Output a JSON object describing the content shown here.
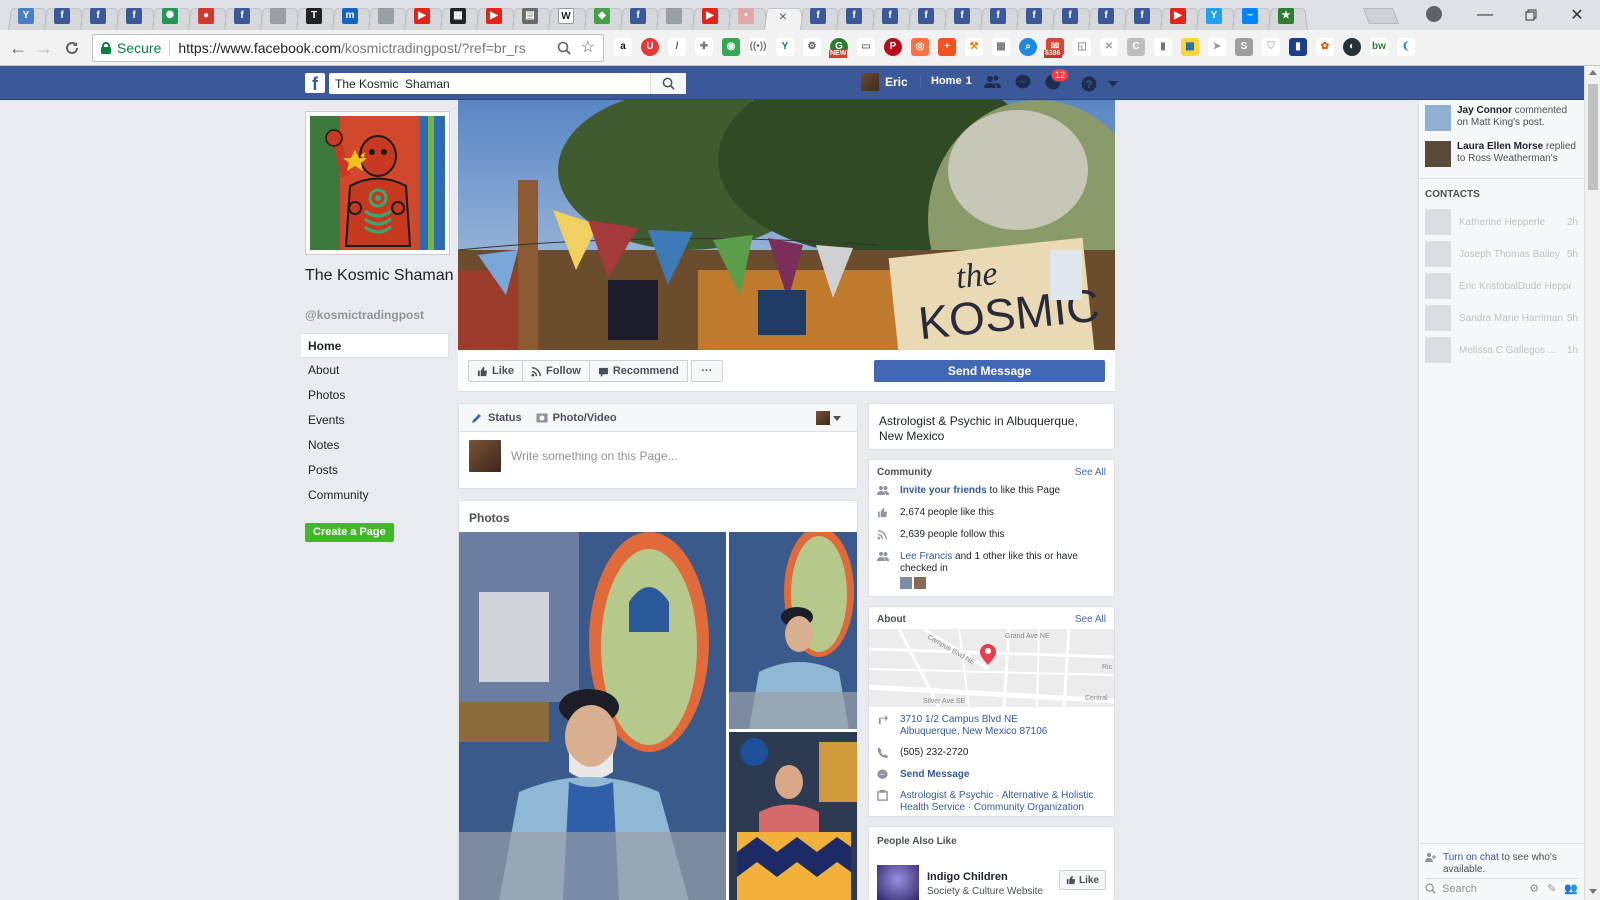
{
  "browser": {
    "tabs": [
      {
        "icon": "vivaldi-icon",
        "color": "#4a7ec9",
        "glyph": "Y"
      },
      {
        "icon": "facebook-icon",
        "color": "#3b5998",
        "glyph": "f"
      },
      {
        "icon": "facebook-icon",
        "color": "#3b5998",
        "glyph": "f"
      },
      {
        "icon": "facebook-icon",
        "color": "#3b5998",
        "glyph": "f"
      },
      {
        "icon": "starbucks-icon",
        "color": "#21975a",
        "glyph": "✺"
      },
      {
        "icon": "red-circle-icon",
        "color": "#d3382f",
        "glyph": "●"
      },
      {
        "icon": "facebook-icon",
        "color": "#3b5998",
        "glyph": "f"
      },
      {
        "icon": "document-icon",
        "color": "#9aa0a6",
        "glyph": ""
      },
      {
        "icon": "nytimes-icon",
        "color": "#222222",
        "glyph": "T"
      },
      {
        "icon": "m-icon",
        "color": "#1565c0",
        "glyph": "m"
      },
      {
        "icon": "document-icon",
        "color": "#9aa0a6",
        "glyph": ""
      },
      {
        "icon": "youtube-icon",
        "color": "#e62117",
        "glyph": "▶"
      },
      {
        "icon": "bbc-icon",
        "color": "#222222",
        "glyph": "▦"
      },
      {
        "icon": "youtube-icon",
        "color": "#e62117",
        "glyph": "▶"
      },
      {
        "icon": "image-icon",
        "color": "#6b6b6b",
        "glyph": "▤"
      },
      {
        "icon": "wikipedia-icon",
        "color": "#ffffff",
        "glyph": "W"
      },
      {
        "icon": "shield-icon",
        "color": "#43a047",
        "glyph": "◆"
      },
      {
        "icon": "facebook-icon",
        "color": "#3b5998",
        "glyph": "f"
      },
      {
        "icon": "document-icon",
        "color": "#9aa0a6",
        "glyph": ""
      },
      {
        "icon": "youtube-icon",
        "color": "#e62117",
        "glyph": "▶"
      },
      {
        "icon": "loading-icon",
        "color": "#e0a8a8",
        "glyph": "•"
      }
    ],
    "active_tab_close": "×",
    "tabs_after": [
      {
        "icon": "facebook-icon",
        "color": "#3b5998",
        "glyph": "f"
      },
      {
        "icon": "facebook-icon",
        "color": "#3b5998",
        "glyph": "f"
      },
      {
        "icon": "facebook-icon",
        "color": "#3b5998",
        "glyph": "f"
      },
      {
        "icon": "facebook-icon",
        "color": "#3b5998",
        "glyph": "f"
      },
      {
        "icon": "facebook-icon",
        "color": "#3b5998",
        "glyph": "f"
      },
      {
        "icon": "facebook-icon",
        "color": "#3b5998",
        "glyph": "f"
      },
      {
        "icon": "facebook-icon",
        "color": "#3b5998",
        "glyph": "f"
      },
      {
        "icon": "facebook-icon",
        "color": "#3b5998",
        "glyph": "f"
      },
      {
        "icon": "facebook-icon",
        "color": "#3b5998",
        "glyph": "f"
      },
      {
        "icon": "facebook-icon",
        "color": "#3b5998",
        "glyph": "f"
      },
      {
        "icon": "youtube-icon",
        "color": "#e62117",
        "glyph": "▶"
      },
      {
        "icon": "vivaldi-icon",
        "color": "#1da1f2",
        "glyph": "Y"
      },
      {
        "icon": "messenger-icon",
        "color": "#0084ff",
        "glyph": "~"
      },
      {
        "icon": "star-icon",
        "color": "#2e7d32",
        "glyph": "★"
      }
    ],
    "secure_label": "Secure",
    "url_host": "https://www.facebook.com",
    "url_path": "/kosmictradingpost/?ref=br_rs",
    "extension_badges": {
      "new": "NEW",
      "mail_count": "6386"
    }
  },
  "fb": {
    "search_value": "The Kosmic  Shaman",
    "user_name": "Eric",
    "home_label": "Home",
    "home_count": "1",
    "notif_count": "12"
  },
  "page": {
    "name": "The Kosmic Shaman",
    "handle": "@kosmictradingpost",
    "nav": [
      "Home",
      "About",
      "Photos",
      "Events",
      "Notes",
      "Posts",
      "Community"
    ],
    "create_page": "Create a Page",
    "cover_sign": "the KOSMIC"
  },
  "actions": {
    "like": "Like",
    "follow": "Follow",
    "recommend": "Recommend",
    "more": "···",
    "send_message": "Send Message"
  },
  "composer": {
    "status": "Status",
    "photo_video": "Photo/Video",
    "placeholder": "Write something on this Page..."
  },
  "photos": {
    "title": "Photos"
  },
  "category_card": {
    "text": "Astrologist & Psychic in Albuquerque, New Mexico"
  },
  "community": {
    "title": "Community",
    "see_all": "See All",
    "invite_link": "Invite your friends",
    "invite_rest": " to like this Page",
    "likes": "2,674 people like this",
    "follows": "2,639 people follow this",
    "friend_link": "Lee Francis",
    "friend_rest": " and 1 other like this or have checked in"
  },
  "about": {
    "title": "About",
    "see_all": "See All",
    "map_labels": {
      "campus": "Campus Blvd NE",
      "grand": "Grand Ave NE",
      "silver": "Silver Ave SE",
      "central": "Central",
      "ric": "Ric"
    },
    "address_line1": "3710 1/2 Campus Blvd NE",
    "address_line2": "Albuquerque, New Mexico 87106",
    "phone": "(505) 232-2720",
    "send_message": "Send Message",
    "categories_line1": "Astrologist & Psychic · Alternative & Holistic",
    "categories_line2": "Health Service · Community Organization"
  },
  "people_also_like": {
    "title": "People Also Like",
    "item_name": "Indigo Children",
    "item_sub": "Society & Culture Website",
    "like": "Like"
  },
  "chat": {
    "ticker": [
      {
        "name": "Jay Connor",
        "rest": " commented on Matt King's post."
      },
      {
        "name": "Laura Ellen Morse",
        "rest": " replied to Ross Weatherman's comment."
      }
    ],
    "contacts_title": "CONTACTS",
    "contacts": [
      {
        "name": "Katherine Hepperle",
        "time": "2h"
      },
      {
        "name": "Joseph Thomas Bailey",
        "time": "5h"
      },
      {
        "name": "Eric KristobalDude Hepperle",
        "time": ""
      },
      {
        "name": "Sandra Marie Harriman",
        "time": "5h"
      },
      {
        "name": "Melissa C Gallegos ...",
        "time": "1h"
      }
    ],
    "turn_on_link": "Turn on chat",
    "turn_on_rest": " to see who's available.",
    "search_placeholder": "Search"
  }
}
